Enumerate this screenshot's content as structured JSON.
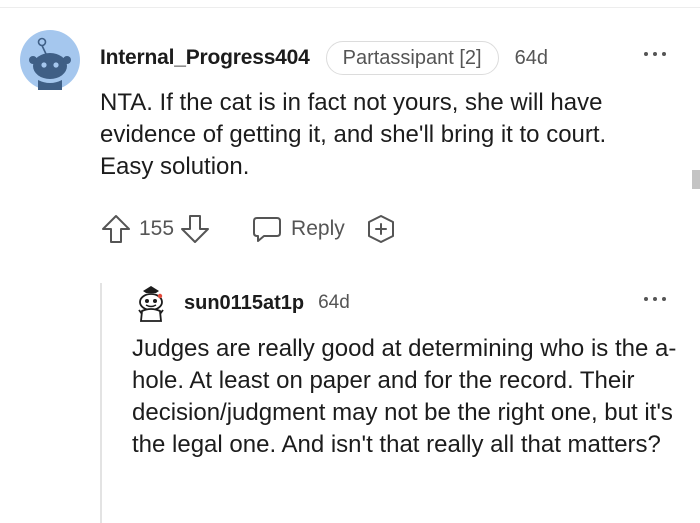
{
  "comment": {
    "author": "Internal_Progress404",
    "flair": "Partassipant [2]",
    "age": "64d",
    "body": "NTA. If the cat is in fact not yours, she will have evidence of getting it, and she'll bring it to court. Easy solution.",
    "votes": "155",
    "reply_label": "Reply"
  },
  "reply": {
    "author": "sun0115at1p",
    "age": "64d",
    "body": "Judges are really good at determining who is the a-hole. At least on paper and for the record. Their decision/judgment may not be the right one, but it's the legal one. And isn't that really all that matters?"
  },
  "icons": {
    "upvote": "upvote-arrow-icon",
    "downvote": "downvote-arrow-icon",
    "reply": "chat-bubble-icon",
    "award": "award-plus-icon",
    "more": "more-options-icon"
  },
  "colors": {
    "avatar_bg": "#a5c7ee",
    "text": "#1c1c1c",
    "meta": "#555555",
    "thread_line": "#e3e3e3"
  }
}
